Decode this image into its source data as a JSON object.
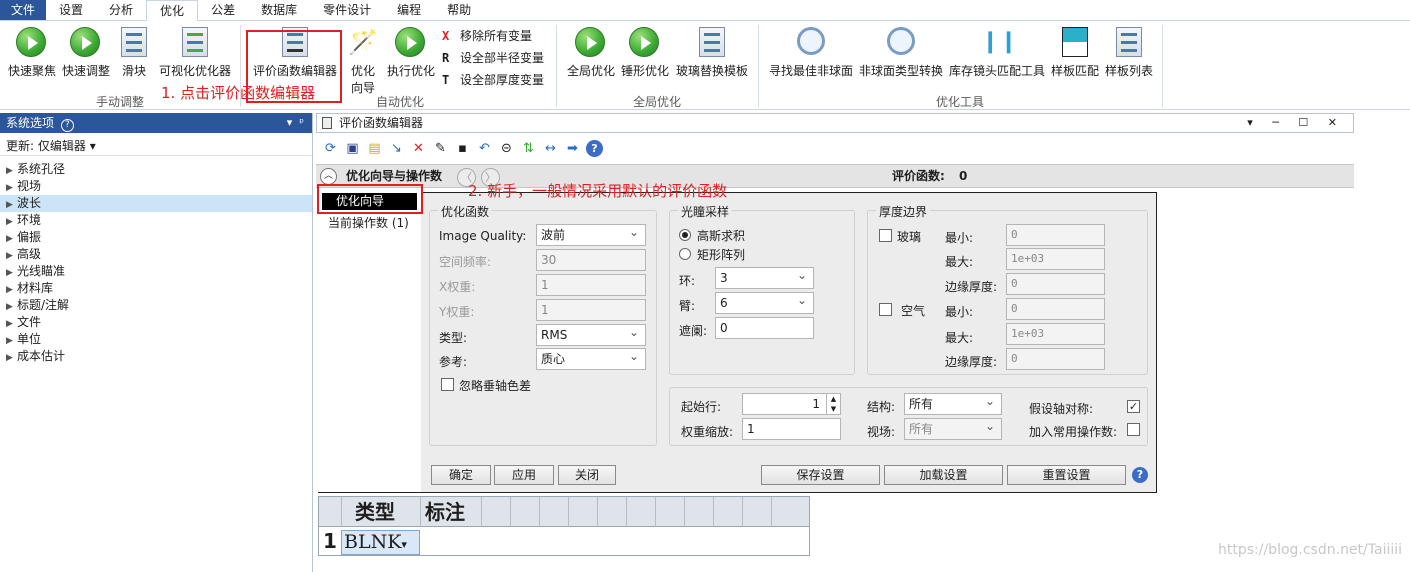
{
  "menu": [
    "文件",
    "设置",
    "分析",
    "优化",
    "公差",
    "数据库",
    "零件设计",
    "编程",
    "帮助"
  ],
  "ribbon": {
    "buttons": {
      "quick_focus": "快速聚焦",
      "quick_adjust": "快速调整",
      "slider": "滑块",
      "visual_optimizer": "可视化优化器",
      "merit_editor": "评价函数编辑器",
      "opt_wizard_1": "优化",
      "opt_wizard_2": "向导",
      "run_opt": "执行优化",
      "remove_vars": "移除所有变量",
      "set_radius_vars": "设全部半径变量",
      "set_thickness_vars": "设全部厚度变量",
      "global_opt": "全局优化",
      "hammer_opt": "锤形优化",
      "glass_sub": "玻璃替换模板",
      "find_asphere": "寻找最佳非球面",
      "asphere_convert": "非球面类型转换",
      "stock_lens": "库存镜头匹配工具",
      "test_plate_match": "样板匹配",
      "test_plate_list": "样板列表"
    },
    "groups": {
      "manual": "手动调整",
      "auto": "自动优化",
      "global": "全局优化",
      "tools": "优化工具"
    }
  },
  "annotations": {
    "step1": "1. 点击评价函数编辑器",
    "step2": "2. 新手，一般情况采用默认的评价函数"
  },
  "left_panel": {
    "title": "系统选项",
    "update": "更新: 仅编辑器",
    "items": [
      "系统孔径",
      "视场",
      "波长",
      "环境",
      "偏振",
      "高级",
      "光线瞄准",
      "材料库",
      "标题/注解",
      "文件",
      "单位",
      "成本估计"
    ]
  },
  "editor": {
    "title": "评价函数编辑器",
    "bar_title": "优化向导与操作数",
    "merit_label": "评价函数:",
    "merit_value": "0",
    "nav": {
      "wizard": "优化向导",
      "operands": "当前操作数 (1)"
    },
    "opt_func": {
      "legend": "优化函数",
      "image_quality_label": "Image Quality:",
      "image_quality_value": "波前",
      "spatial_freq_label": "空间频率:",
      "spatial_freq_value": "30",
      "x_weight_label": "X权重:",
      "x_weight_value": "1",
      "y_weight_label": "Y权重:",
      "y_weight_value": "1",
      "type_label": "类型:",
      "type_value": "RMS",
      "ref_label": "参考:",
      "ref_value": "质心",
      "ignore_lateral": "忽略垂轴色差"
    },
    "pupil": {
      "legend": "光瞳采样",
      "gauss": "高斯求积",
      "rect": "矩形阵列",
      "rings_label": "环:",
      "rings_value": "3",
      "arms_label": "臂:",
      "arms_value": "6",
      "obscuration_label": "遮阑:",
      "obscuration_value": "0"
    },
    "thickness": {
      "legend": "厚度边界",
      "glass": "玻璃",
      "air": "空气",
      "min_label": "最小:",
      "max_label": "最大:",
      "edge_label": "边缘厚度:",
      "glass_min": "0",
      "glass_max": "1e+03",
      "glass_edge": "0",
      "air_min": "0",
      "air_max": "1e+03",
      "air_edge": "0"
    },
    "lower": {
      "start_row_label": "起始行:",
      "start_row_value": "1",
      "weight_scale_label": "权重缩放:",
      "weight_scale_value": "1",
      "config_label": "结构:",
      "config_value": "所有",
      "field_label": "视场:",
      "field_value": "所有",
      "assume_axial_label": "假设轴对称:",
      "add_common_label": "加入常用操作数:"
    },
    "buttons": {
      "ok": "确定",
      "apply": "应用",
      "close": "关闭",
      "save": "保存设置",
      "load": "加载设置",
      "reset": "重置设置"
    }
  },
  "grid": {
    "col_type": "类型",
    "col_comment": "标注",
    "row_num": "1",
    "row_type": "BLNK"
  },
  "watermark": "https://blog.csdn.net/Taiiiii"
}
